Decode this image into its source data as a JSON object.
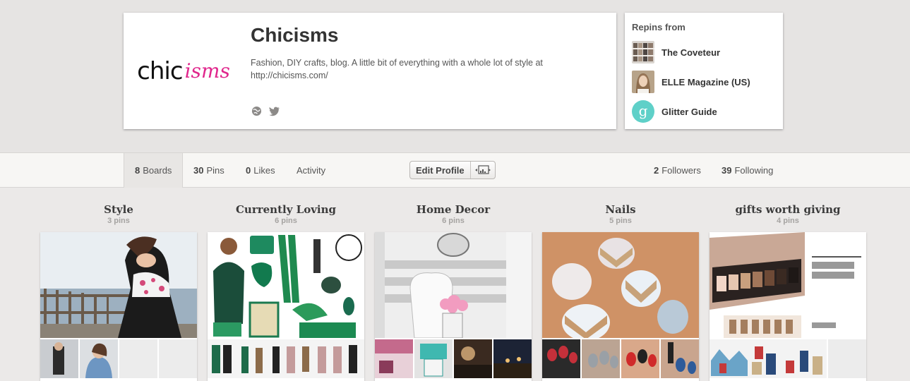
{
  "profile": {
    "logo_main": "chic",
    "logo_accent": "isms",
    "name": "Chicisms",
    "bio": "Fashion, DIY crafts, blog. A little bit of everything with a whole lot of style at http://chicisms.com/",
    "icons": [
      "globe-icon",
      "twitter-bird-icon"
    ]
  },
  "repins": {
    "title": "Repins from",
    "items": [
      {
        "name": "The Coveteur",
        "icon": "coveteur-avatar"
      },
      {
        "name": "ELLE Magazine (US)",
        "icon": "elle-avatar"
      },
      {
        "name": "Glitter Guide",
        "icon": "glitter-guide-avatar"
      }
    ]
  },
  "nav": {
    "boards_count": "8",
    "boards_label": "Boards",
    "pins_count": "30",
    "pins_label": "Pins",
    "likes_count": "0",
    "likes_label": "Likes",
    "activity_label": "Activity",
    "edit_profile_label": "Edit Profile",
    "followers_count": "2",
    "followers_label": "Followers",
    "following_count": "39",
    "following_label": "Following"
  },
  "boards": [
    {
      "title": "Style",
      "count": "3 pins"
    },
    {
      "title": "Currently Loving",
      "count": "6 pins"
    },
    {
      "title": "Home Decor",
      "count": "6 pins"
    },
    {
      "title": "Nails",
      "count": "5 pins"
    },
    {
      "title": "gifts worth giving",
      "count": "4 pins"
    }
  ],
  "colors": {
    "brand_pink": "#e0268c",
    "glitter_teal": "#5fd0c8",
    "page_bg": "#ebe9e8"
  }
}
